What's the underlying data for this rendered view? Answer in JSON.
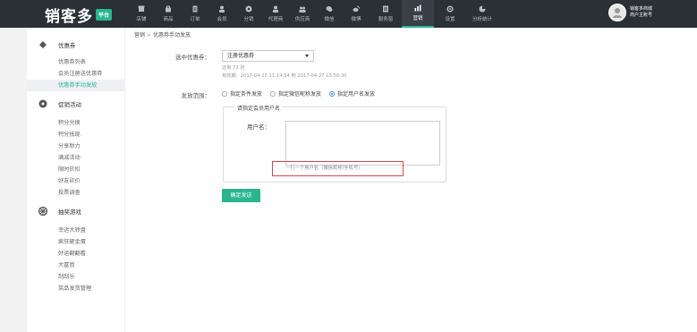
{
  "header": {
    "logo_text": "销客多",
    "logo_badge": "平台",
    "nav": [
      {
        "label": "店铺",
        "icon": "store-icon"
      },
      {
        "label": "商品",
        "icon": "goods-icon"
      },
      {
        "label": "订单",
        "icon": "order-icon"
      },
      {
        "label": "会员",
        "icon": "member-icon"
      },
      {
        "label": "分销",
        "icon": "distribution-icon"
      },
      {
        "label": "代理商",
        "icon": "agent-icon"
      },
      {
        "label": "供应商",
        "icon": "supplier-icon"
      },
      {
        "label": "微信",
        "icon": "wechat-icon"
      },
      {
        "label": "微博",
        "icon": "weibo-icon"
      },
      {
        "label": "服务窗",
        "icon": "service-window-icon"
      },
      {
        "label": "营销",
        "icon": "marketing-icon",
        "active": true
      },
      {
        "label": "设置",
        "icon": "settings-icon"
      },
      {
        "label": "分析统计",
        "icon": "analytics-icon"
      }
    ],
    "user": {
      "line1": "销客多商城",
      "line2": "商户主账号"
    }
  },
  "sidebar": {
    "groups": [
      {
        "label": "优惠券",
        "icon": "coupon-icon",
        "items": [
          "优惠券列表",
          "会员注册送优惠券",
          "优惠券手动发放"
        ]
      },
      {
        "label": "促销活动",
        "icon": "promotion-icon",
        "items": [
          "积分兑换",
          "积分抵现",
          "分享助力",
          "满减活动",
          "限时折扣",
          "好友砍价",
          "投票调查"
        ]
      },
      {
        "label": "抽奖游戏",
        "icon": "lottery-icon",
        "items": [
          "幸运大转盘",
          "疯狂砸金蛋",
          "好运翻翻看",
          "大富翁",
          "刮刮乐",
          "奖品发货管理"
        ]
      }
    ],
    "active_item": "优惠券手动发放"
  },
  "breadcrumb": {
    "parent": "营销",
    "separator": ">",
    "current": "优惠券手动发放"
  },
  "form": {
    "coupon_label": "选中优惠券：",
    "coupon_selected": "注册优惠券",
    "remaining": "还剩 72 张",
    "validity": "有效期：2017-04-25 11:14:54 到 2017-04-27 10:50:30",
    "scope_label": "发放范围：",
    "scope_options": [
      {
        "label": "指定条件发放",
        "checked": false
      },
      {
        "label": "指定微信昵称发放",
        "checked": false
      },
      {
        "label": "指定用户名发放",
        "checked": true
      }
    ],
    "fieldset_legend": "请指定会员用户名",
    "username_label": "用户名：",
    "username_value": "",
    "hint": "一行一个用户名（微信昵称/手机号）",
    "submit_label": "确定发送"
  },
  "colors": {
    "accent": "#2ab58e",
    "topbar": "#2b2f36",
    "hint_border": "#e0414a"
  }
}
